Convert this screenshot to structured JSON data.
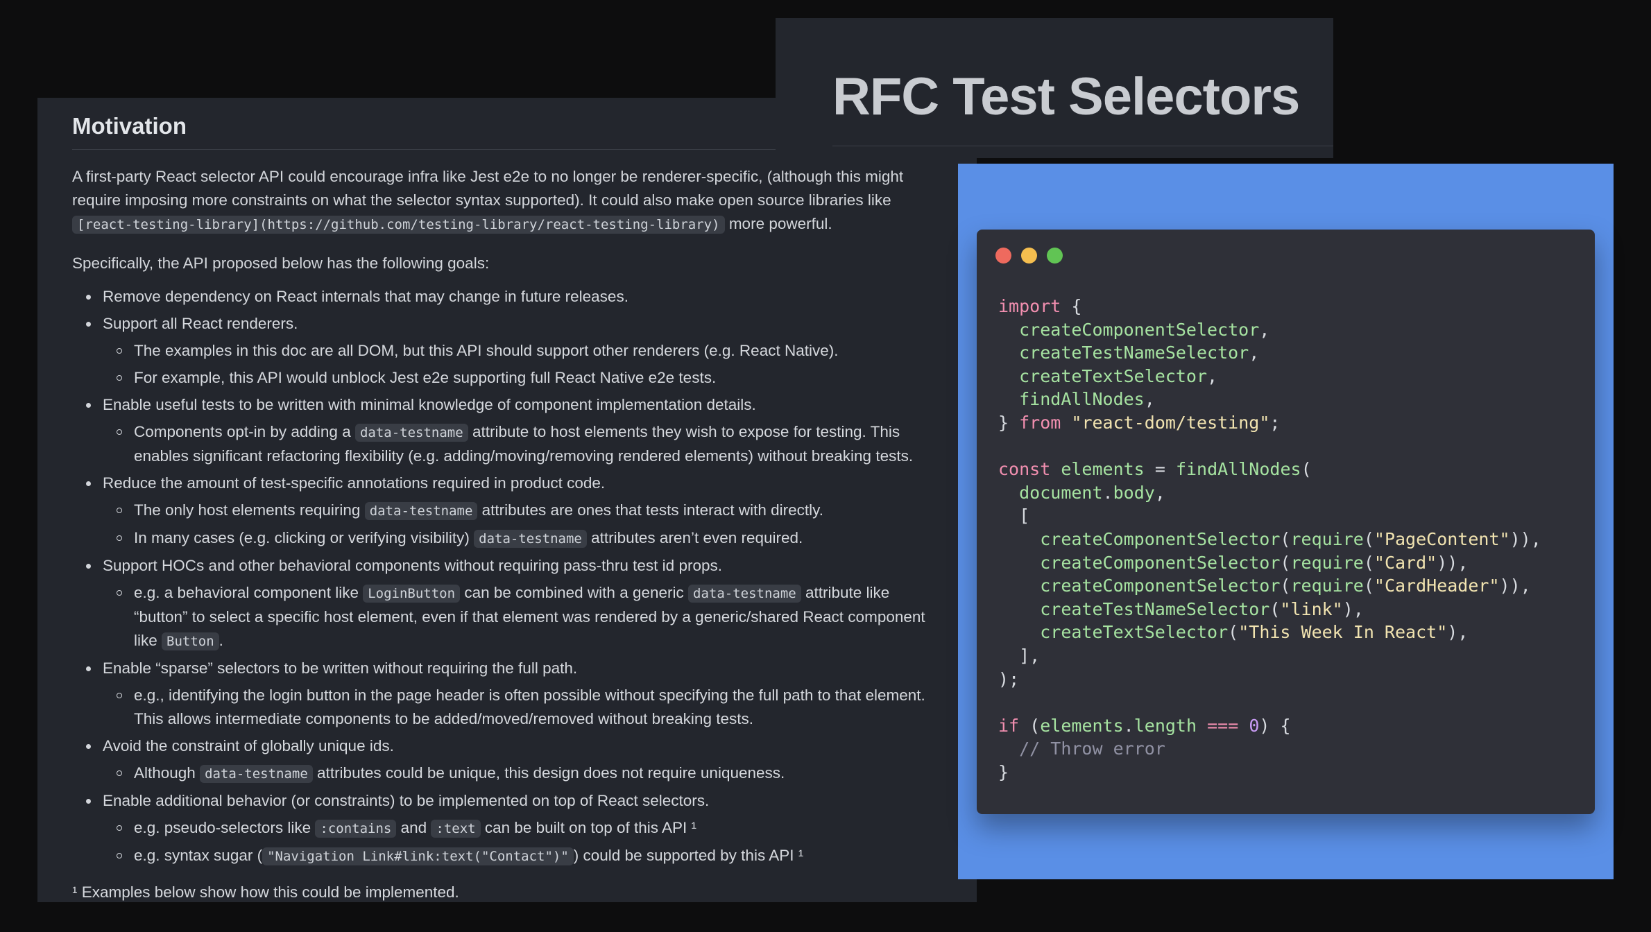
{
  "title": "RFC Test Selectors",
  "doc": {
    "heading": "Motivation",
    "intro": {
      "text1": "A first-party React selector API could encourage infra like Jest e2e to no longer be renderer-specific, (although this might require imposing more constraints on what the selector syntax supported). It could also make open source libraries like ",
      "code": "[react-testing-library](https://github.com/testing-library/react-testing-library)",
      "text2": " more powerful."
    },
    "goals_intro": "Specifically, the API proposed below has the following goals:",
    "goals": [
      {
        "text": "Remove dependency on React internals that may change in future releases.",
        "sub": []
      },
      {
        "text": "Support all React renderers.",
        "sub": [
          "The examples in this doc are all DOM, but this API should support other renderers (e.g. React Native).",
          "For example, this API would unblock Jest e2e supporting full React Native e2e tests."
        ]
      },
      {
        "text": "Enable useful tests to be written with minimal knowledge of component implementation details.",
        "sub_rich": {
          "a": "Components opt-in by adding a ",
          "code": "data-testname",
          "b": " attribute to host elements they wish to expose for testing. This enables significant refactoring flexibility (e.g. adding/moving/removing rendered elements) without breaking tests."
        }
      },
      {
        "text": "Reduce the amount of test-specific annotations required in product code.",
        "sub1": {
          "a": "The only host elements requiring ",
          "code": "data-testname",
          "b": " attributes are ones that tests interact with directly."
        },
        "sub2": {
          "a": "In many cases (e.g. clicking or verifying visibility) ",
          "code": "data-testname",
          "b": " attributes aren’t even required."
        }
      },
      {
        "text": "Support HOCs and other behavioral components without requiring pass-thru test id props.",
        "sub": {
          "a": "e.g. a behavioral component like ",
          "code1": "LoginButton",
          "b": " can be combined with a generic ",
          "code2": "data-testname",
          "c": " attribute like “button” to select a specific host element, even if that element was rendered by a generic/shared React component like ",
          "code3": "Button",
          "d": "."
        }
      },
      {
        "text": "Enable “sparse” selectors to be written without requiring the full path.",
        "sub": "e.g., identifying the login button in the page header is often possible without specifying the full path to that element. This allows intermediate components to be added/moved/removed without breaking tests."
      },
      {
        "text": "Avoid the constraint of globally unique ids.",
        "sub": {
          "a": "Although ",
          "code": "data-testname",
          "b": " attributes could be unique, this design does not require uniqueness."
        }
      },
      {
        "text": "Enable additional behavior (or constraints) to be implemented on top of React selectors.",
        "sub1": {
          "a": "e.g. pseudo-selectors like ",
          "code1": ":contains",
          "b": " and ",
          "code2": ":text",
          "c": " can be built on top of this API ¹"
        },
        "sub2": {
          "a": "e.g. syntax sugar (",
          "code": "\"Navigation Link#link:text(\"Contact\")\"",
          "b": ") could be supported by this API ¹"
        }
      }
    ],
    "footnote": "¹ Examples below show how this could be implemented."
  },
  "code": {
    "lines": [
      "import {",
      "  createComponentSelector,",
      "  createTestNameSelector,",
      "  createTextSelector,",
      "  findAllNodes,",
      "} from \"react-dom/testing\";",
      "",
      "const elements = findAllNodes(",
      "  document.body,",
      "  [",
      "    createComponentSelector(require(\"PageContent\")),",
      "    createComponentSelector(require(\"Card\")),",
      "    createComponentSelector(require(\"CardHeader\")),",
      "    createTestNameSelector(\"link\"),",
      "    createTextSelector(\"This Week In React\"),",
      "  ],",
      ");",
      "",
      "if (elements.length === 0) {",
      "  // Throw error",
      "}"
    ],
    "colors": {
      "keyword": "#f28fb0",
      "function": "#a6e3a1",
      "string": "#f1e3b0",
      "number": "#c99cf5",
      "comment": "#9091a3"
    }
  }
}
